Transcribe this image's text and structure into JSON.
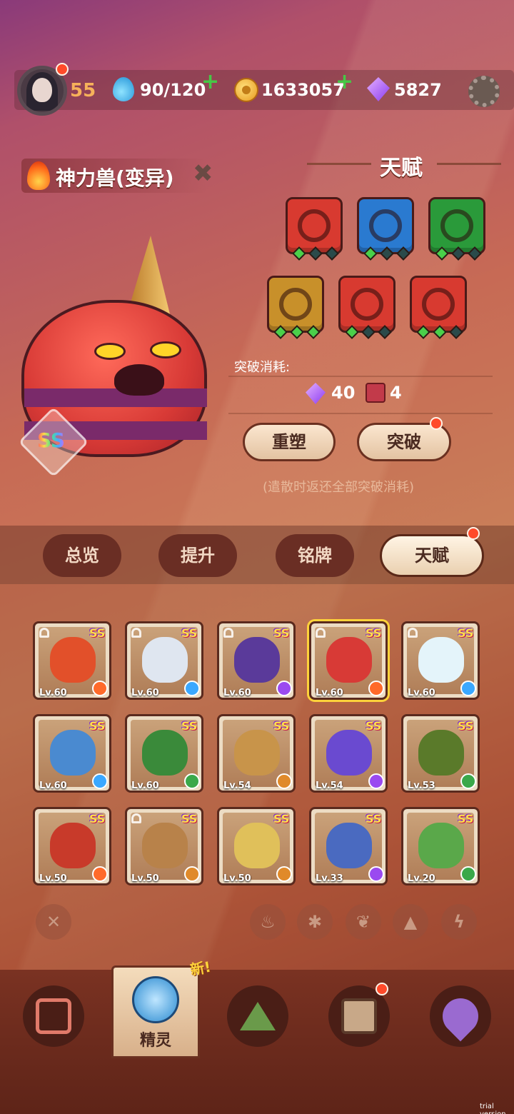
{
  "header": {
    "level": "55",
    "energy": "90/120",
    "gold": "1633057",
    "gems": "5827"
  },
  "creature": {
    "name": "神力兽(变异)",
    "rarity": "SS"
  },
  "talent": {
    "title": "天赋",
    "tiles": [
      {
        "color": "#d83a30",
        "gems": [
          1,
          0,
          0
        ]
      },
      {
        "color": "#2a7ad0",
        "gems": [
          1,
          0,
          0
        ]
      },
      {
        "color": "#2a9a3a",
        "gems": [
          1,
          0,
          0
        ]
      },
      {
        "color": "#c8902a",
        "gems": [
          1,
          1,
          1
        ]
      },
      {
        "color": "#d83a30",
        "gems": [
          1,
          0,
          0
        ]
      },
      {
        "color": "#d83a30",
        "gems": [
          1,
          1,
          0
        ]
      }
    ],
    "cost_label": "突破消耗:",
    "cost_gems": "40",
    "cost_books": "4",
    "reshape_button": "重塑",
    "breakthrough_button": "突破",
    "note": "(遣散时返还全部突破消耗)"
  },
  "tabs": [
    "总览",
    "提升",
    "铭牌",
    "天赋"
  ],
  "creatures": [
    {
      "lv": "Lv.60",
      "rarity": "SS",
      "color": "#e2502a",
      "element": "fire",
      "locked": true
    },
    {
      "lv": "Lv.60",
      "rarity": "SS",
      "color": "#dfe6f0",
      "element": "ice",
      "locked": true
    },
    {
      "lv": "Lv.60",
      "rarity": "SS",
      "color": "#5a3a9a",
      "element": "electric",
      "locked": true
    },
    {
      "lv": "Lv.60",
      "rarity": "SS",
      "color": "#d83a36",
      "element": "fire",
      "locked": true,
      "selected": true
    },
    {
      "lv": "Lv.60",
      "rarity": "SS",
      "color": "#e4f4fa",
      "element": "ice",
      "locked": true
    },
    {
      "lv": "Lv.60",
      "rarity": "SS",
      "color": "#4a8ad0",
      "element": "ice",
      "locked": false
    },
    {
      "lv": "Lv.60",
      "rarity": "SS",
      "color": "#3a8a3a",
      "element": "grass",
      "locked": false
    },
    {
      "lv": "Lv.54",
      "rarity": "SS",
      "color": "#c8944a",
      "element": "earth",
      "locked": false
    },
    {
      "lv": "Lv.54",
      "rarity": "SS",
      "color": "#6a4ad0",
      "element": "electric",
      "locked": false
    },
    {
      "lv": "Lv.53",
      "rarity": "SS",
      "color": "#5a7a2a",
      "element": "grass",
      "locked": false
    },
    {
      "lv": "Lv.50",
      "rarity": "SS",
      "color": "#c83a2a",
      "element": "fire",
      "locked": false
    },
    {
      "lv": "Lv.50",
      "rarity": "SS",
      "color": "#b8824a",
      "element": "earth",
      "locked": true
    },
    {
      "lv": "Lv.50",
      "rarity": "SS",
      "color": "#e0c05a",
      "element": "earth",
      "locked": false
    },
    {
      "lv": "Lv.33",
      "rarity": "SS",
      "color": "#4a6ac0",
      "element": "electric",
      "locked": false
    },
    {
      "lv": "Lv.20",
      "rarity": "SS",
      "color": "#5aa84a",
      "element": "grass",
      "locked": false
    }
  ],
  "element_colors": {
    "fire": "#ff6a2a",
    "ice": "#3aa8ff",
    "electric": "#9a4af0",
    "grass": "#3aa84a",
    "earth": "#e08a2a"
  },
  "filters": [
    "✕",
    "fire-icon",
    "ice-icon",
    "grass-icon",
    "earth-icon",
    "electric-icon"
  ],
  "nav": {
    "active_label": "精灵",
    "new_tag": "新!"
  },
  "watermark": "trial version"
}
